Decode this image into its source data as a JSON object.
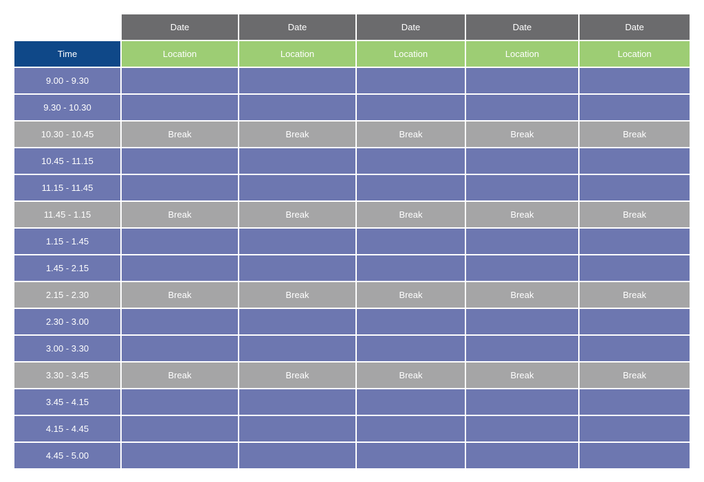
{
  "header": {
    "dates": [
      "Date",
      "Date",
      "Date",
      "Date",
      "Date"
    ],
    "time_label": "Time",
    "locations": [
      "Location",
      "Location",
      "Location",
      "Location",
      "Location"
    ]
  },
  "rows": [
    {
      "time": "9.00 - 9.30",
      "type": "session",
      "cells": [
        "",
        "",
        "",
        "",
        ""
      ]
    },
    {
      "time": "9.30 - 10.30",
      "type": "session",
      "cells": [
        "",
        "",
        "",
        "",
        ""
      ]
    },
    {
      "time": "10.30 - 10.45",
      "type": "break",
      "cells": [
        "Break",
        "Break",
        "Break",
        "Break",
        "Break"
      ]
    },
    {
      "time": "10.45 - 11.15",
      "type": "session",
      "cells": [
        "",
        "",
        "",
        "",
        ""
      ]
    },
    {
      "time": "11.15 - 11.45",
      "type": "session",
      "cells": [
        "",
        "",
        "",
        "",
        ""
      ]
    },
    {
      "time": "11.45 - 1.15",
      "type": "break",
      "cells": [
        "Break",
        "Break",
        "Break",
        "Break",
        "Break"
      ]
    },
    {
      "time": "1.15 - 1.45",
      "type": "session",
      "cells": [
        "",
        "",
        "",
        "",
        ""
      ]
    },
    {
      "time": "1.45 - 2.15",
      "type": "session",
      "cells": [
        "",
        "",
        "",
        "",
        ""
      ]
    },
    {
      "time": "2.15 - 2.30",
      "type": "break",
      "cells": [
        "Break",
        "Break",
        "Break",
        "Break",
        "Break"
      ]
    },
    {
      "time": "2.30 - 3.00",
      "type": "session",
      "cells": [
        "",
        "",
        "",
        "",
        ""
      ]
    },
    {
      "time": "3.00 - 3.30",
      "type": "session",
      "cells": [
        "",
        "",
        "",
        "",
        ""
      ]
    },
    {
      "time": "3.30 - 3.45",
      "type": "break",
      "cells": [
        "Break",
        "Break",
        "Break",
        "Break",
        "Break"
      ]
    },
    {
      "time": "3.45 - 4.15",
      "type": "session",
      "cells": [
        "",
        "",
        "",
        "",
        ""
      ]
    },
    {
      "time": "4.15 - 4.45",
      "type": "session",
      "cells": [
        "",
        "",
        "",
        "",
        ""
      ]
    },
    {
      "time": "4.45 - 5.00",
      "type": "session",
      "cells": [
        "",
        "",
        "",
        "",
        ""
      ]
    }
  ],
  "colors": {
    "date_header": "#6b6b6d",
    "time_header": "#0f4888",
    "location_header": "#9dcd74",
    "session": "#6d77b0",
    "break": "#a5a5a6"
  }
}
